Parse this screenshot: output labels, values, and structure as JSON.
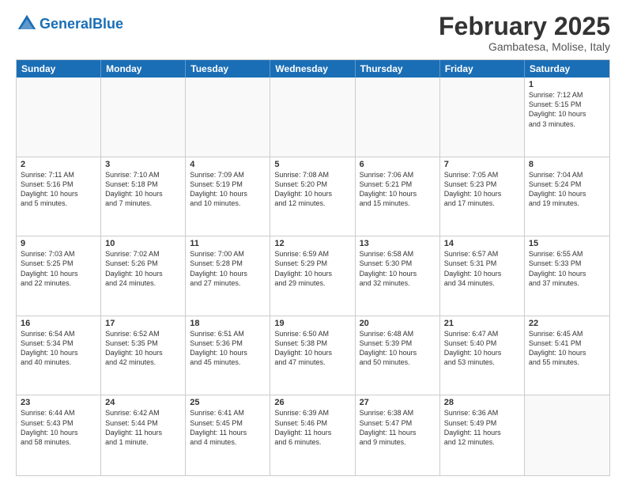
{
  "header": {
    "logo_general": "General",
    "logo_blue": "Blue",
    "main_title": "February 2025",
    "subtitle": "Gambatesa, Molise, Italy"
  },
  "days_of_week": [
    "Sunday",
    "Monday",
    "Tuesday",
    "Wednesday",
    "Thursday",
    "Friday",
    "Saturday"
  ],
  "weeks": [
    [
      {
        "day": "",
        "info": ""
      },
      {
        "day": "",
        "info": ""
      },
      {
        "day": "",
        "info": ""
      },
      {
        "day": "",
        "info": ""
      },
      {
        "day": "",
        "info": ""
      },
      {
        "day": "",
        "info": ""
      },
      {
        "day": "1",
        "info": "Sunrise: 7:12 AM\nSunset: 5:15 PM\nDaylight: 10 hours\nand 3 minutes."
      }
    ],
    [
      {
        "day": "2",
        "info": "Sunrise: 7:11 AM\nSunset: 5:16 PM\nDaylight: 10 hours\nand 5 minutes."
      },
      {
        "day": "3",
        "info": "Sunrise: 7:10 AM\nSunset: 5:18 PM\nDaylight: 10 hours\nand 7 minutes."
      },
      {
        "day": "4",
        "info": "Sunrise: 7:09 AM\nSunset: 5:19 PM\nDaylight: 10 hours\nand 10 minutes."
      },
      {
        "day": "5",
        "info": "Sunrise: 7:08 AM\nSunset: 5:20 PM\nDaylight: 10 hours\nand 12 minutes."
      },
      {
        "day": "6",
        "info": "Sunrise: 7:06 AM\nSunset: 5:21 PM\nDaylight: 10 hours\nand 15 minutes."
      },
      {
        "day": "7",
        "info": "Sunrise: 7:05 AM\nSunset: 5:23 PM\nDaylight: 10 hours\nand 17 minutes."
      },
      {
        "day": "8",
        "info": "Sunrise: 7:04 AM\nSunset: 5:24 PM\nDaylight: 10 hours\nand 19 minutes."
      }
    ],
    [
      {
        "day": "9",
        "info": "Sunrise: 7:03 AM\nSunset: 5:25 PM\nDaylight: 10 hours\nand 22 minutes."
      },
      {
        "day": "10",
        "info": "Sunrise: 7:02 AM\nSunset: 5:26 PM\nDaylight: 10 hours\nand 24 minutes."
      },
      {
        "day": "11",
        "info": "Sunrise: 7:00 AM\nSunset: 5:28 PM\nDaylight: 10 hours\nand 27 minutes."
      },
      {
        "day": "12",
        "info": "Sunrise: 6:59 AM\nSunset: 5:29 PM\nDaylight: 10 hours\nand 29 minutes."
      },
      {
        "day": "13",
        "info": "Sunrise: 6:58 AM\nSunset: 5:30 PM\nDaylight: 10 hours\nand 32 minutes."
      },
      {
        "day": "14",
        "info": "Sunrise: 6:57 AM\nSunset: 5:31 PM\nDaylight: 10 hours\nand 34 minutes."
      },
      {
        "day": "15",
        "info": "Sunrise: 6:55 AM\nSunset: 5:33 PM\nDaylight: 10 hours\nand 37 minutes."
      }
    ],
    [
      {
        "day": "16",
        "info": "Sunrise: 6:54 AM\nSunset: 5:34 PM\nDaylight: 10 hours\nand 40 minutes."
      },
      {
        "day": "17",
        "info": "Sunrise: 6:52 AM\nSunset: 5:35 PM\nDaylight: 10 hours\nand 42 minutes."
      },
      {
        "day": "18",
        "info": "Sunrise: 6:51 AM\nSunset: 5:36 PM\nDaylight: 10 hours\nand 45 minutes."
      },
      {
        "day": "19",
        "info": "Sunrise: 6:50 AM\nSunset: 5:38 PM\nDaylight: 10 hours\nand 47 minutes."
      },
      {
        "day": "20",
        "info": "Sunrise: 6:48 AM\nSunset: 5:39 PM\nDaylight: 10 hours\nand 50 minutes."
      },
      {
        "day": "21",
        "info": "Sunrise: 6:47 AM\nSunset: 5:40 PM\nDaylight: 10 hours\nand 53 minutes."
      },
      {
        "day": "22",
        "info": "Sunrise: 6:45 AM\nSunset: 5:41 PM\nDaylight: 10 hours\nand 55 minutes."
      }
    ],
    [
      {
        "day": "23",
        "info": "Sunrise: 6:44 AM\nSunset: 5:43 PM\nDaylight: 10 hours\nand 58 minutes."
      },
      {
        "day": "24",
        "info": "Sunrise: 6:42 AM\nSunset: 5:44 PM\nDaylight: 11 hours\nand 1 minute."
      },
      {
        "day": "25",
        "info": "Sunrise: 6:41 AM\nSunset: 5:45 PM\nDaylight: 11 hours\nand 4 minutes."
      },
      {
        "day": "26",
        "info": "Sunrise: 6:39 AM\nSunset: 5:46 PM\nDaylight: 11 hours\nand 6 minutes."
      },
      {
        "day": "27",
        "info": "Sunrise: 6:38 AM\nSunset: 5:47 PM\nDaylight: 11 hours\nand 9 minutes."
      },
      {
        "day": "28",
        "info": "Sunrise: 6:36 AM\nSunset: 5:49 PM\nDaylight: 11 hours\nand 12 minutes."
      },
      {
        "day": "",
        "info": ""
      }
    ]
  ]
}
